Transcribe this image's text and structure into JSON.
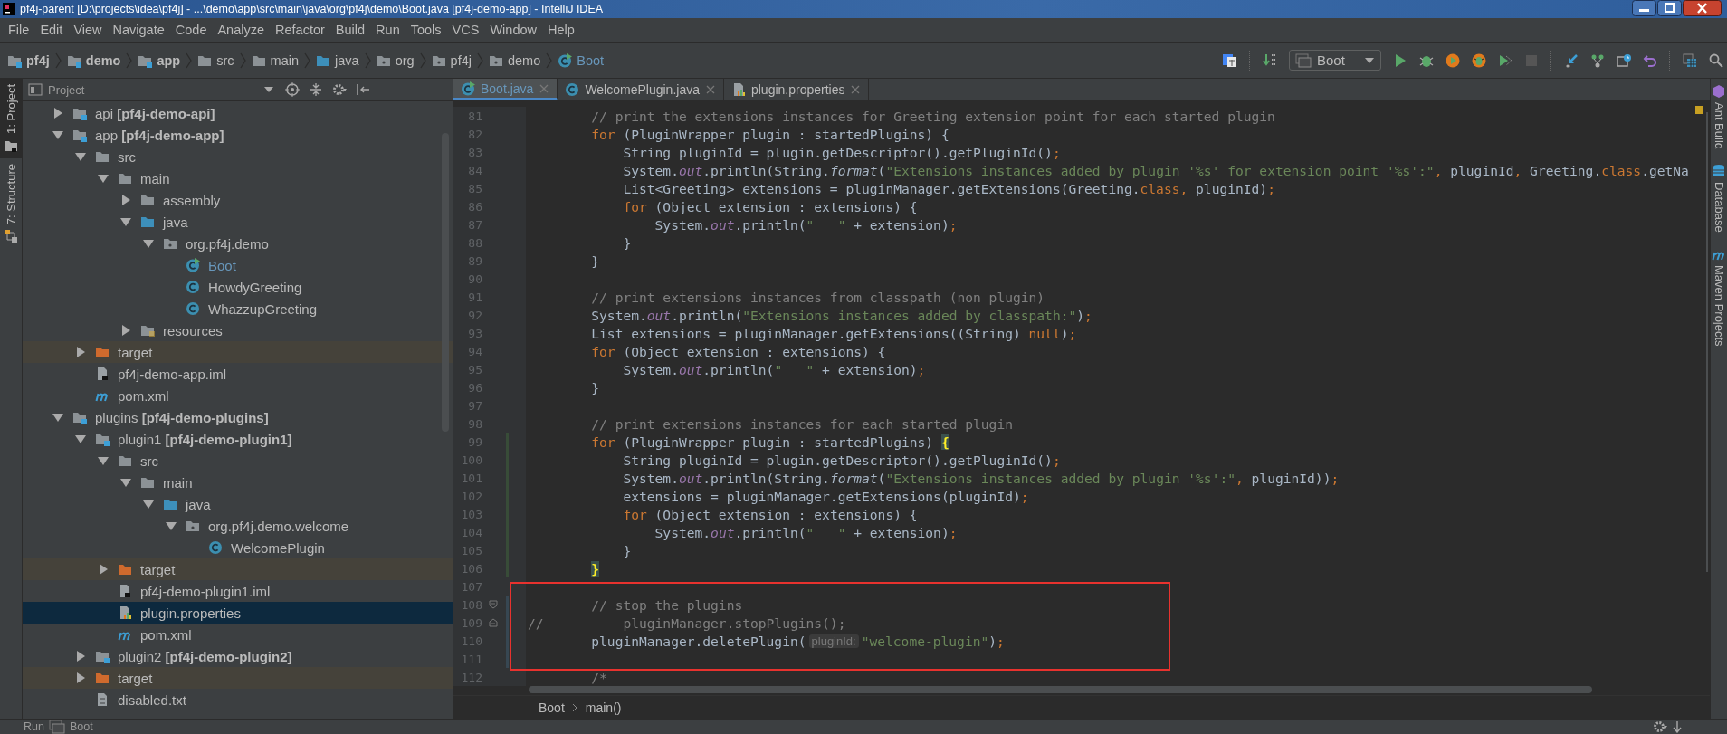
{
  "window": {
    "title": "pf4j-parent [D:\\projects\\idea\\pf4j] - ...\\demo\\app\\src\\main\\java\\org\\pf4j\\demo\\Boot.java [pf4j-demo-app] - IntelliJ IDEA"
  },
  "menu": [
    "File",
    "Edit",
    "View",
    "Navigate",
    "Code",
    "Analyze",
    "Refactor",
    "Build",
    "Run",
    "Tools",
    "VCS",
    "Window",
    "Help"
  ],
  "navigation_bar": [
    {
      "label": "pf4j",
      "kind": "module",
      "bold": true,
      "modified": false
    },
    {
      "label": "demo",
      "kind": "module",
      "bold": true,
      "modified": false
    },
    {
      "label": "app",
      "kind": "module",
      "bold": true,
      "modified": false
    },
    {
      "label": "src",
      "kind": "folder",
      "bold": false,
      "modified": false
    },
    {
      "label": "main",
      "kind": "folder",
      "bold": false,
      "modified": false
    },
    {
      "label": "java",
      "kind": "source-folder",
      "bold": false,
      "modified": false
    },
    {
      "label": "org",
      "kind": "package",
      "bold": false,
      "modified": false
    },
    {
      "label": "pf4j",
      "kind": "package",
      "bold": false,
      "modified": false
    },
    {
      "label": "demo",
      "kind": "package",
      "bold": false,
      "modified": false
    },
    {
      "label": "Boot",
      "kind": "runnable-class",
      "bold": false,
      "modified": true
    }
  ],
  "toolbar": {
    "run_configuration": "Boot"
  },
  "left_tool_strip": [
    {
      "label": "1: Project",
      "selected": true
    },
    {
      "label": "7: Structure",
      "selected": false
    }
  ],
  "right_tool_strip": [
    "Ant Build",
    "Database",
    "Maven Projects"
  ],
  "project_panel": {
    "title": "Project",
    "tree": [
      {
        "label": "api **[pf4j-demo-api]**",
        "kind": "module",
        "expanded": false,
        "selected": false,
        "modified": false
      },
      {
        "label": "app **[pf4j-demo-app]**",
        "kind": "module",
        "expanded": true,
        "selected": false,
        "modified": false,
        "children": [
          {
            "label": "src",
            "kind": "folder",
            "expanded": true,
            "selected": false,
            "modified": false,
            "children": [
              {
                "label": "main",
                "kind": "folder",
                "expanded": true,
                "selected": false,
                "modified": false,
                "children": [
                  {
                    "label": "assembly",
                    "kind": "folder",
                    "expanded": false,
                    "selected": false,
                    "modified": false
                  },
                  {
                    "label": "java",
                    "kind": "source-folder",
                    "expanded": true,
                    "selected": false,
                    "modified": false,
                    "children": [
                      {
                        "label": "org.pf4j.demo",
                        "kind": "package",
                        "expanded": true,
                        "selected": false,
                        "modified": false,
                        "children": [
                          {
                            "label": "Boot",
                            "kind": "runnable-class",
                            "selected": false,
                            "modified": true
                          },
                          {
                            "label": "HowdyGreeting",
                            "kind": "class",
                            "selected": false,
                            "modified": false
                          },
                          {
                            "label": "WhazzupGreeting",
                            "kind": "class",
                            "selected": false,
                            "modified": false
                          }
                        ]
                      }
                    ]
                  },
                  {
                    "label": "resources",
                    "kind": "resources",
                    "expanded": false,
                    "selected": false,
                    "modified": false
                  }
                ]
              }
            ]
          },
          {
            "label": "target",
            "kind": "excluded-folder",
            "expanded": false,
            "selected": false,
            "modified": false
          },
          {
            "label": "pf4j-demo-app.iml",
            "kind": "module-file",
            "selected": false,
            "modified": false
          },
          {
            "label": "pom.xml",
            "kind": "maven",
            "selected": false,
            "modified": false
          }
        ]
      },
      {
        "label": "plugins **[pf4j-demo-plugins]**",
        "kind": "module",
        "expanded": true,
        "selected": false,
        "modified": false,
        "children": [
          {
            "label": "plugin1 **[pf4j-demo-plugin1]**",
            "kind": "module",
            "expanded": true,
            "selected": false,
            "modified": false,
            "children": [
              {
                "label": "src",
                "kind": "folder",
                "expanded": true,
                "selected": false,
                "modified": false,
                "children": [
                  {
                    "label": "main",
                    "kind": "folder",
                    "expanded": true,
                    "selected": false,
                    "modified": false,
                    "children": [
                      {
                        "label": "java",
                        "kind": "source-folder",
                        "expanded": true,
                        "selected": false,
                        "modified": false,
                        "children": [
                          {
                            "label": "org.pf4j.demo.welcome",
                            "kind": "package",
                            "expanded": true,
                            "selected": false,
                            "modified": false,
                            "children": [
                              {
                                "label": "WelcomePlugin",
                                "kind": "class",
                                "selected": false,
                                "modified": false
                              }
                            ]
                          }
                        ]
                      }
                    ]
                  }
                ]
              },
              {
                "label": "target",
                "kind": "excluded-folder",
                "expanded": false,
                "selected": false,
                "modified": false
              },
              {
                "label": "pf4j-demo-plugin1.iml",
                "kind": "module-file",
                "selected": false,
                "modified": false
              },
              {
                "label": "plugin.properties",
                "kind": "properties",
                "selected": true,
                "modified": false
              },
              {
                "label": "pom.xml",
                "kind": "maven",
                "selected": false,
                "modified": false
              }
            ]
          },
          {
            "label": "plugin2 **[pf4j-demo-plugin2]**",
            "kind": "module",
            "expanded": false,
            "selected": false,
            "modified": false
          },
          {
            "label": "target",
            "kind": "excluded-folder",
            "expanded": false,
            "selected": false,
            "modified": false
          },
          {
            "label": "disabled.txt",
            "kind": "text-file",
            "selected": false,
            "modified": false
          }
        ]
      }
    ]
  },
  "editor": {
    "tabs": [
      {
        "label": "Boot.java",
        "kind": "runnable-class",
        "selected": true,
        "modified": true
      },
      {
        "label": "WelcomePlugin.java",
        "kind": "class",
        "selected": false,
        "modified": false
      },
      {
        "label": "plugin.properties",
        "kind": "properties",
        "selected": false,
        "modified": false
      }
    ],
    "lines": [
      {
        "number": "81",
        "tokens": [
          {
            "kind": "comment",
            "text": "        // print the extensions instances for Greeting extension point for each started plugin"
          }
        ]
      },
      {
        "number": "82",
        "tokens": [
          {
            "kind": "keyword",
            "text": "        for"
          },
          {
            "kind": "plain",
            "text": " (PluginWrapper plugin : startedPlugins) {"
          }
        ]
      },
      {
        "number": "83",
        "tokens": [
          {
            "kind": "plain",
            "text": "            String pluginId = plugin.getDescriptor().getPluginId()"
          },
          {
            "kind": "keyword",
            "text": ";"
          }
        ]
      },
      {
        "number": "84",
        "tokens": [
          {
            "kind": "plain",
            "text": "            System."
          },
          {
            "kind": "field",
            "text": "out"
          },
          {
            "kind": "plain",
            "text": ".println(String."
          },
          {
            "kind": "italic",
            "text": "format"
          },
          {
            "kind": "plain",
            "text": "("
          },
          {
            "kind": "string",
            "text": "\"Extensions instances added by plugin '%s' for extension point '%s':\""
          },
          {
            "kind": "keyword",
            "text": ","
          },
          {
            "kind": "plain",
            "text": " pluginId"
          },
          {
            "kind": "keyword",
            "text": ","
          },
          {
            "kind": "plain",
            "text": " Greeting."
          },
          {
            "kind": "keyword",
            "text": "class"
          },
          {
            "kind": "plain",
            "text": ".getNa"
          }
        ]
      },
      {
        "number": "85",
        "tokens": [
          {
            "kind": "plain",
            "text": "            List<Greeting> extensions = pluginManager.getExtensions(Greeting."
          },
          {
            "kind": "keyword",
            "text": "class"
          },
          {
            "kind": "keyword",
            "text": ","
          },
          {
            "kind": "plain",
            "text": " pluginId)"
          },
          {
            "kind": "keyword",
            "text": ";"
          }
        ]
      },
      {
        "number": "86",
        "tokens": [
          {
            "kind": "keyword",
            "text": "            for"
          },
          {
            "kind": "plain",
            "text": " (Object extension : extensions) {"
          }
        ]
      },
      {
        "number": "87",
        "tokens": [
          {
            "kind": "plain",
            "text": "                System."
          },
          {
            "kind": "field",
            "text": "out"
          },
          {
            "kind": "plain",
            "text": ".println("
          },
          {
            "kind": "string",
            "text": "\"   \""
          },
          {
            "kind": "plain",
            "text": " + extension)"
          },
          {
            "kind": "keyword",
            "text": ";"
          }
        ]
      },
      {
        "number": "88",
        "tokens": [
          {
            "kind": "plain",
            "text": "            }"
          }
        ]
      },
      {
        "number": "89",
        "tokens": [
          {
            "kind": "plain",
            "text": "        }"
          }
        ]
      },
      {
        "number": "90"
      },
      {
        "number": "91",
        "tokens": [
          {
            "kind": "comment",
            "text": "        // print extensions instances from classpath (non plugin)"
          }
        ]
      },
      {
        "number": "92",
        "tokens": [
          {
            "kind": "plain",
            "text": "        System."
          },
          {
            "kind": "field",
            "text": "out"
          },
          {
            "kind": "plain",
            "text": ".println("
          },
          {
            "kind": "string",
            "text": "\"Extensions instances added by classpath:\""
          },
          {
            "kind": "plain",
            "text": ")"
          },
          {
            "kind": "keyword",
            "text": ";"
          }
        ]
      },
      {
        "number": "93",
        "tokens": [
          {
            "kind": "plain",
            "text": "        List extensions = pluginManager.getExtensions((String) "
          },
          {
            "kind": "keyword",
            "text": "null"
          },
          {
            "kind": "plain",
            "text": ")"
          },
          {
            "kind": "keyword",
            "text": ";"
          }
        ]
      },
      {
        "number": "94",
        "tokens": [
          {
            "kind": "keyword",
            "text": "        for"
          },
          {
            "kind": "plain",
            "text": " (Object extension : extensions) {"
          }
        ]
      },
      {
        "number": "95",
        "tokens": [
          {
            "kind": "plain",
            "text": "            System."
          },
          {
            "kind": "field",
            "text": "out"
          },
          {
            "kind": "plain",
            "text": ".println("
          },
          {
            "kind": "string",
            "text": "\"   \""
          },
          {
            "kind": "plain",
            "text": " + extension)"
          },
          {
            "kind": "keyword",
            "text": ";"
          }
        ]
      },
      {
        "number": "96",
        "tokens": [
          {
            "kind": "plain",
            "text": "        }"
          }
        ]
      },
      {
        "number": "97"
      },
      {
        "number": "98",
        "tokens": [
          {
            "kind": "comment",
            "text": "        // print extensions instances for each started plugin"
          }
        ]
      },
      {
        "number": "99",
        "color": "#384c38",
        "tokens": [
          {
            "kind": "keyword",
            "text": "        for"
          },
          {
            "kind": "plain",
            "text": " (PluginWrapper plugin : startedPlugins) "
          },
          {
            "kind": "brace",
            "text": "{"
          }
        ]
      },
      {
        "number": "100",
        "color": "#384c38",
        "tokens": [
          {
            "kind": "plain",
            "text": "            String pluginId = plugin.getDescriptor().getPluginId()"
          },
          {
            "kind": "keyword",
            "text": ";"
          }
        ]
      },
      {
        "number": "101",
        "color": "#384c38",
        "tokens": [
          {
            "kind": "plain",
            "text": "            System."
          },
          {
            "kind": "field",
            "text": "out"
          },
          {
            "kind": "plain",
            "text": ".println(String."
          },
          {
            "kind": "italic",
            "text": "format"
          },
          {
            "kind": "plain",
            "text": "("
          },
          {
            "kind": "string",
            "text": "\"Extensions instances added by plugin '%s':\""
          },
          {
            "kind": "keyword",
            "text": ","
          },
          {
            "kind": "plain",
            "text": " pluginId))"
          },
          {
            "kind": "keyword",
            "text": ";"
          }
        ]
      },
      {
        "number": "102",
        "color": "#384c38",
        "tokens": [
          {
            "kind": "plain",
            "text": "            extensions = pluginManager.getExtensions(pluginId)"
          },
          {
            "kind": "keyword",
            "text": ";"
          }
        ]
      },
      {
        "number": "103",
        "color": "#384c38",
        "tokens": [
          {
            "kind": "keyword",
            "text": "            for"
          },
          {
            "kind": "plain",
            "text": " (Object extension : extensions) {"
          }
        ]
      },
      {
        "number": "104",
        "color": "#384c38",
        "tokens": [
          {
            "kind": "plain",
            "text": "                System."
          },
          {
            "kind": "field",
            "text": "out"
          },
          {
            "kind": "plain",
            "text": ".println("
          },
          {
            "kind": "string",
            "text": "\"   \""
          },
          {
            "kind": "plain",
            "text": " + extension)"
          },
          {
            "kind": "keyword",
            "text": ";"
          }
        ]
      },
      {
        "number": "105",
        "color": "#384c38",
        "tokens": [
          {
            "kind": "plain",
            "text": "            }"
          }
        ]
      },
      {
        "number": "106",
        "color": "#384c38",
        "tokens": [
          {
            "kind": "brace",
            "text": "        }"
          }
        ]
      },
      {
        "number": "107"
      },
      {
        "number": "108",
        "color": "#374752",
        "kind": "fold-start",
        "tokens": [
          {
            "kind": "comment",
            "text": "        // stop the plugins"
          }
        ]
      },
      {
        "number": "109",
        "color": "#374752",
        "kind": "fold-end",
        "tokens": [
          {
            "kind": "comment",
            "text": "//          pluginManager.stopPlugins();"
          }
        ]
      },
      {
        "number": "110",
        "color": "#374752",
        "tokens": [
          {
            "kind": "plain",
            "text": "        pluginManager.deletePlugin("
          },
          {
            "kind": "hint",
            "text": "pluginId:"
          },
          {
            "kind": "string",
            "text": "\"welcome-plugin\""
          },
          {
            "kind": "plain",
            "text": ")"
          },
          {
            "kind": "keyword",
            "text": ";"
          }
        ]
      },
      {
        "number": "111",
        "color": "#374752"
      },
      {
        "number": "112",
        "tokens": [
          {
            "kind": "comment",
            "text": "        /*"
          }
        ]
      }
    ],
    "breadcrumb": [
      "Boot",
      "main()"
    ]
  },
  "status_bar": {
    "tool_window": "Run",
    "run_target": "Boot"
  }
}
